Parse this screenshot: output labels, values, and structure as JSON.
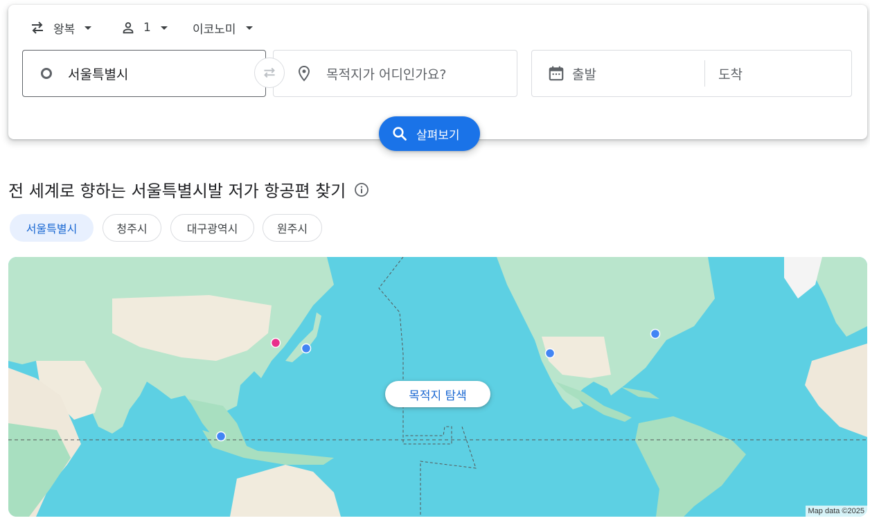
{
  "search": {
    "trip_type": "왕복",
    "passengers": "1",
    "cabin_class": "이코노미",
    "origin_value": "서울특별시",
    "destination_placeholder": "목적지가 어디인가요?",
    "depart_placeholder": "출발",
    "return_placeholder": "도착",
    "explore_label": "살펴보기"
  },
  "section": {
    "heading": "전 세계로 향하는 서울특별시발 저가 항공편 찾기"
  },
  "chips": [
    {
      "label": "서울특별시",
      "selected": true
    },
    {
      "label": "청주시",
      "selected": false
    },
    {
      "label": "대구광역시",
      "selected": false
    },
    {
      "label": "원주시",
      "selected": false
    }
  ],
  "map": {
    "cta_label": "목적지 탐색",
    "attribution": "Map data ©2025",
    "colors": {
      "water": "#5dd0e3",
      "land_green": "#a8e0c6",
      "land_sand": "#f3ece0",
      "origin_marker": "#e8308c",
      "destination_marker": "#4285f4"
    }
  },
  "colors": {
    "accent": "#1a73e8",
    "chip_selected_bg": "#e8f0fe"
  }
}
